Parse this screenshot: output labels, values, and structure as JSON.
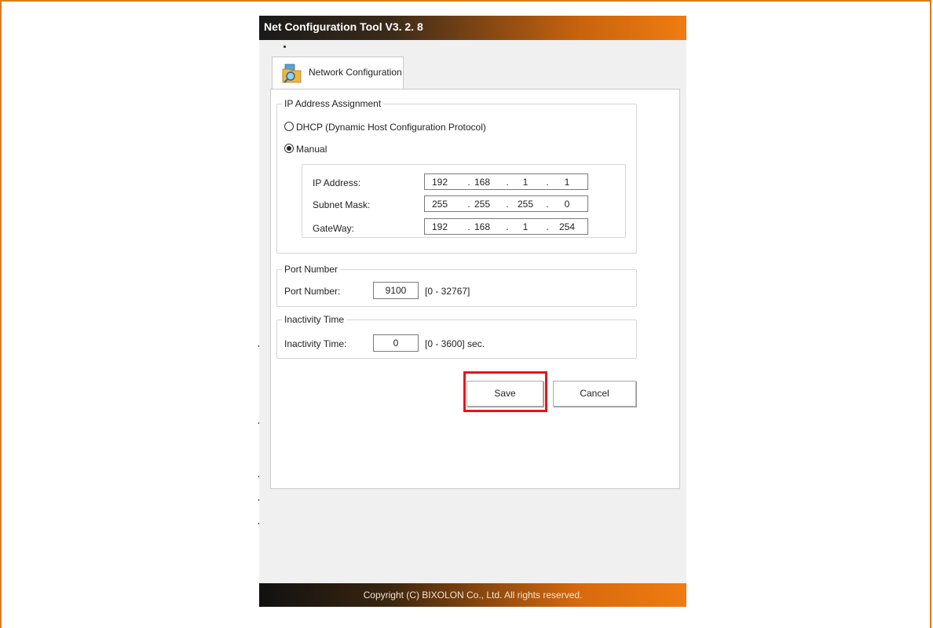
{
  "window": {
    "title": "Net Configuration Tool V3. 2. 8"
  },
  "tab": {
    "label": "Network Configuration",
    "icon": "folder-magnifier-icon"
  },
  "ip_group": {
    "title": "IP Address Assignment",
    "dhcp_label": "DHCP (Dynamic Host Configuration Protocol)",
    "manual_label": "Manual",
    "selected": "Manual",
    "fields": [
      {
        "label": "IP Address:",
        "octets": [
          "192",
          "168",
          "1",
          "1"
        ]
      },
      {
        "label": "Subnet Mask:",
        "octets": [
          "255",
          "255",
          "255",
          "0"
        ]
      },
      {
        "label": "GateWay:",
        "octets": [
          "192",
          "168",
          "1",
          "254"
        ]
      }
    ],
    "separator": "."
  },
  "port_group": {
    "title": "Port Number",
    "label": "Port Number:",
    "value": "9100",
    "range": "[0 - 32767]"
  },
  "inactivity_group": {
    "title": "Inactivity Time",
    "label": "Inactivity Time:",
    "value": "0",
    "range": "[0 - 3600] sec."
  },
  "buttons": {
    "save": "Save",
    "cancel": "Cancel"
  },
  "footer": {
    "copyright": "Copyright (C) BIXOLON Co., Ltd. All rights reserved."
  },
  "colors": {
    "accent": "#f07c10",
    "highlight": "#e3151a",
    "border": "#e07a1a"
  }
}
